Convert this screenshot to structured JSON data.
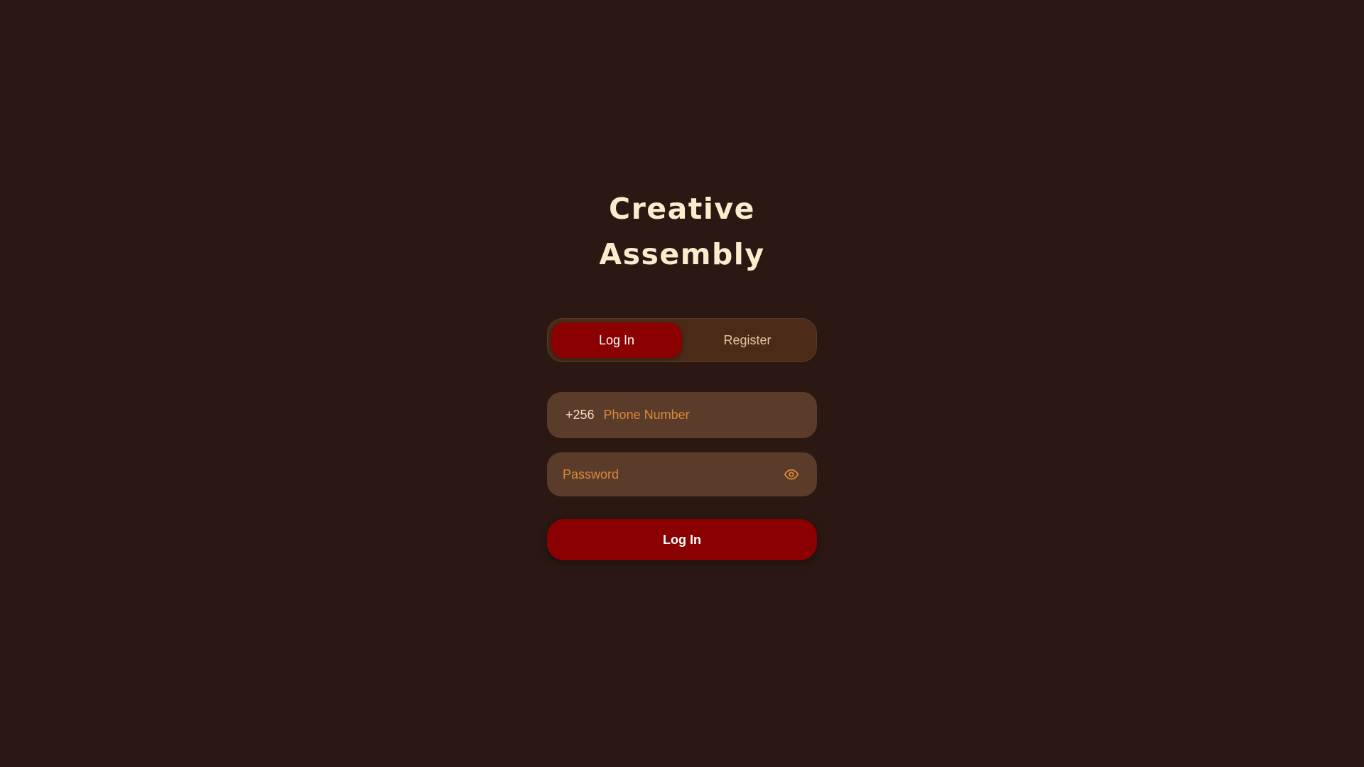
{
  "brand": {
    "line1": "Creative",
    "line2": "Assembly"
  },
  "tabs": [
    {
      "label": "Log In",
      "active": true
    },
    {
      "label": "Register",
      "active": false
    }
  ],
  "phone": {
    "country_code": "+256",
    "value": "",
    "placeholder": "Phone Number"
  },
  "password": {
    "value": "",
    "placeholder": "Password",
    "toggle_icon": "eye-icon"
  },
  "submit": {
    "label": "Log In"
  },
  "colors": {
    "background": "#2b1812",
    "accent": "#8b0000",
    "field": "#5b3b29",
    "placeholder": "#d98a3a",
    "title": "#fbeccd"
  }
}
